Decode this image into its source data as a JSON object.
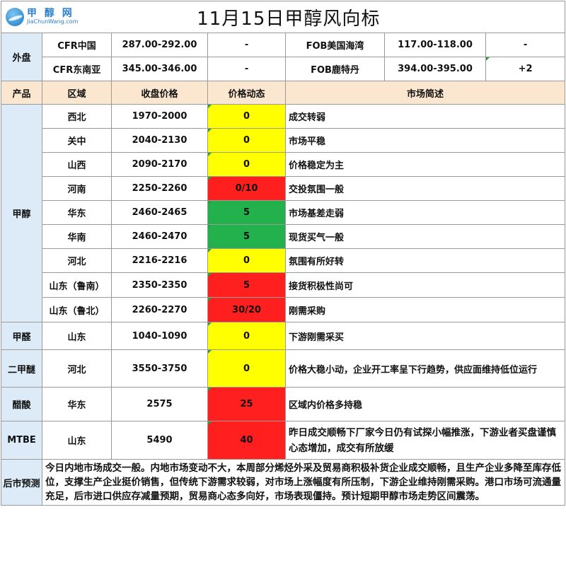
{
  "logo": {
    "cn": "甲 醇 网",
    "en": "JiaChunWang.com"
  },
  "title": "11月15日甲醇风向标",
  "outer": {
    "label": "外盘",
    "rows": [
      {
        "a_name": "CFR中国",
        "a_price": "287.00-292.00",
        "a_change": "-",
        "b_name": "FOB美国海湾",
        "b_price": "117.00-118.00",
        "b_change": "-"
      },
      {
        "a_name": "CFR东南亚",
        "a_price": "345.00-346.00",
        "a_change": "-",
        "b_name": "FOB鹿特丹",
        "b_price": "394.00-395.00",
        "b_change": "+2"
      }
    ]
  },
  "headers": {
    "product": "产品",
    "region": "区域",
    "close": "收盘价格",
    "change": "价格动态",
    "desc": "市场简述"
  },
  "groups": [
    {
      "product": "甲醇",
      "rows": [
        {
          "region": "西北",
          "price": "1970-2000",
          "change": "0",
          "color": "#ffff00",
          "desc": "成交转弱"
        },
        {
          "region": "关中",
          "price": "2040-2130",
          "change": "0",
          "color": "#ffff00",
          "desc": "市场平稳"
        },
        {
          "region": "山西",
          "price": "2090-2170",
          "change": "0",
          "color": "#ffff00",
          "desc": "价格稳定为主"
        },
        {
          "region": "河南",
          "price": "2250-2260",
          "change": "0/10",
          "color": "#ff1f1f",
          "desc": "交投氛围一般"
        },
        {
          "region": "华东",
          "price": "2460-2465",
          "change": "5",
          "color": "#22b14c",
          "desc": "市场基差走弱"
        },
        {
          "region": "华南",
          "price": "2460-2470",
          "change": "5",
          "color": "#22b14c",
          "desc": "现货买气一般"
        },
        {
          "region": "河北",
          "price": "2216-2216",
          "change": "0",
          "color": "#ffff00",
          "desc": "氛围有所好转"
        },
        {
          "region": "山东（鲁南）",
          "price": "2350-2350",
          "change": "5",
          "color": "#ff1f1f",
          "desc": "接货积极性尚可"
        },
        {
          "region": "山东（鲁北）",
          "price": "2260-2270",
          "change": "30/20",
          "color": "#ff1f1f",
          "desc": "刚需采购"
        }
      ]
    },
    {
      "product": "甲醛",
      "rows": [
        {
          "region": "山东",
          "price": "1040-1090",
          "change": "0",
          "color": "#ffff00",
          "desc": "下游刚需采买"
        }
      ]
    },
    {
      "product": "二甲醚",
      "rows": [
        {
          "region": "河北",
          "price": "3550-3750",
          "change": "0",
          "color": "#ffff00",
          "desc": "价格大稳小动，企业开工率呈下行趋势，供应面维持低位运行"
        }
      ]
    },
    {
      "product": "醋酸",
      "rows": [
        {
          "region": "华东",
          "price": "2575",
          "change": "25",
          "color": "#ff1f1f",
          "desc": "区域内价格多持稳"
        }
      ]
    },
    {
      "product": "MTBE",
      "rows": [
        {
          "region": "山东",
          "price": "5490",
          "change": "40",
          "color": "#ff1f1f",
          "desc": "昨日成交顺畅下厂家今日仍有试探小幅推涨，下游业者买盘谨慎心态增加，成交有所放缓"
        }
      ]
    }
  ],
  "forecast": {
    "label": "后市预测",
    "text": "今日内地市场成交一般。内地市场变动不大，本周部分烯烃外采及贸易商积极补货企业成交顺畅，且生产企业多降至库存低位，支撑生产企业挺价销售，但传统下游需求较弱，对市场上涨幅度有所压制，下游企业维持刚需采购。港口市场可流通量充足，后市进口供应存减量预期，贸易商心态多向好，市场表现僵持。预计短期甲醇市场走势区间震荡。"
  }
}
